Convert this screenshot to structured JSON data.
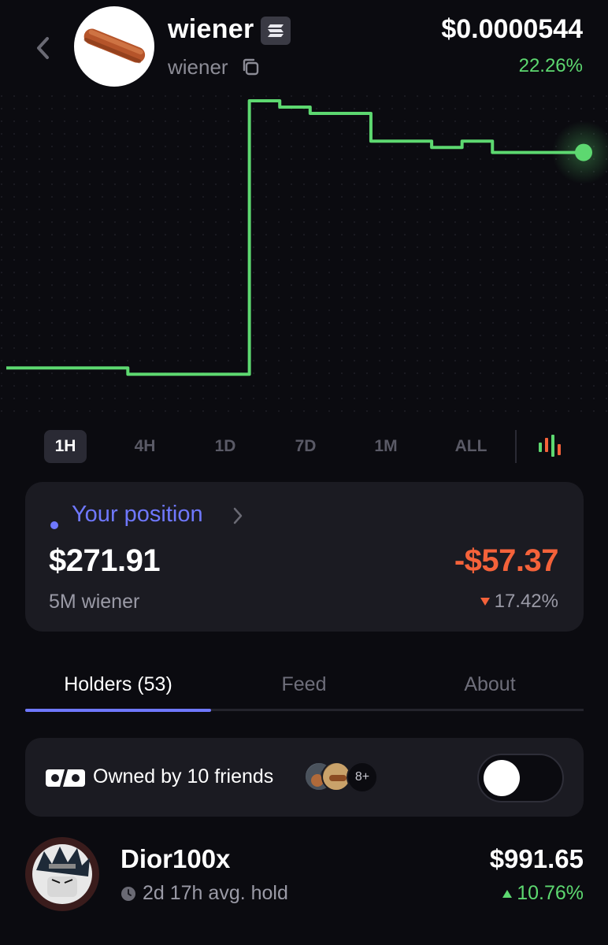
{
  "header": {
    "token_name": "wiener",
    "token_symbol": "wiener",
    "chain_icon": "solana-icon",
    "price": "$0.0000544",
    "change_pct": "22.26%",
    "change_color": "#5dd870"
  },
  "chart_data": {
    "type": "line",
    "title": "",
    "x": [
      0,
      1,
      2,
      3,
      4,
      5,
      6,
      7,
      8,
      9,
      10,
      11,
      12,
      13,
      14,
      15,
      16,
      17,
      18,
      19
    ],
    "values": [
      3.73e-05,
      3.73e-05,
      3.73e-05,
      3.73e-05,
      3.68e-05,
      3.68e-05,
      3.68e-05,
      3.68e-05,
      5.85e-05,
      5.8e-05,
      5.75e-05,
      5.75e-05,
      5.53e-05,
      5.53e-05,
      5.48e-05,
      5.53e-05,
      5.44e-05,
      5.44e-05,
      5.44e-05,
      5.44e-05
    ],
    "line_color": "#5dd870",
    "grid": "dotted"
  },
  "timeframes": {
    "items": [
      "1H",
      "4H",
      "1D",
      "7D",
      "1M",
      "ALL"
    ],
    "active": "1H"
  },
  "position": {
    "label": "Your position",
    "value": "$271.91",
    "amount": "5M wiener",
    "pnl": "-$57.37",
    "pnl_pct": "17.42%",
    "accent": "#6f78ff",
    "loss_color": "#f4623a"
  },
  "tabs": {
    "items": [
      "Holders (53)",
      "Feed",
      "About"
    ],
    "active": "Holders (53)"
  },
  "friends": {
    "text": "Owned by 10 friends",
    "more": "8+",
    "toggle_on": false
  },
  "holders": [
    {
      "name": "Dior100x",
      "hold": "2d 17h avg. hold",
      "value": "$991.65",
      "pct": "10.76%"
    }
  ]
}
